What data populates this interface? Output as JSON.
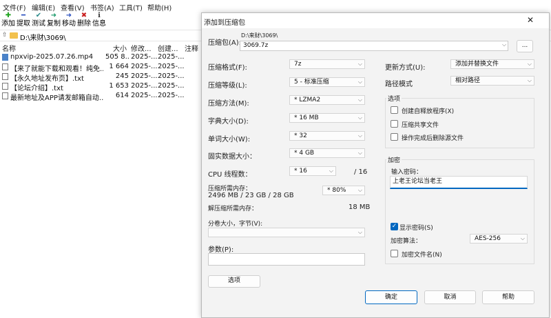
{
  "menu": [
    "文件(F)",
    "编辑(E)",
    "查看(V)",
    "书签(A)",
    "工具(T)",
    "帮助(H)"
  ],
  "toolbar": [
    {
      "label": "添加",
      "icon": "add-icon",
      "glyph": "✚",
      "color": "#1fa31f"
    },
    {
      "label": "提取",
      "icon": "extract-icon",
      "glyph": "━",
      "color": "#2a4fbf"
    },
    {
      "label": "测试",
      "icon": "test-icon",
      "glyph": "✔",
      "color": "#2b8a8a"
    },
    {
      "label": "复制",
      "icon": "copy-icon",
      "glyph": "➜",
      "color": "#1c9a6b"
    },
    {
      "label": "移动",
      "icon": "move-icon",
      "glyph": "➜",
      "color": "#2a4fbf"
    },
    {
      "label": "删除",
      "icon": "delete-icon",
      "glyph": "✖",
      "color": "#c81e1e"
    },
    {
      "label": "信息",
      "icon": "info-icon",
      "glyph": "ℹ",
      "color": "#333333"
    }
  ],
  "address": "D:\\来财\\3069\\",
  "columns": {
    "name": "名称",
    "size": "大小",
    "modified": "修改...",
    "created": "创建...",
    "comment": "注释"
  },
  "files": [
    {
      "name": "npxvip-2025.07.26.mp4",
      "size": "505 8...",
      "modified": "2025-...",
      "created": "2025-..."
    },
    {
      "name": "【来了就能下载和观看！纯免...",
      "size": "1 664",
      "modified": "2025-...",
      "created": "2025-..."
    },
    {
      "name": "【永久地址发布页】.txt",
      "size": "245",
      "modified": "2025-...",
      "created": "2025-..."
    },
    {
      "name": "【论坛介绍】.txt",
      "size": "1 653",
      "modified": "2025-...",
      "created": "2025-..."
    },
    {
      "name": "最新地址及APP请发邮箱自动...",
      "size": "614",
      "modified": "2025-...",
      "created": "2025-..."
    }
  ],
  "dialog": {
    "title": "添加到压缩包",
    "close": "✕",
    "archive_label": "压缩包(A):",
    "archive_path": "D:\\来财\\3069\\",
    "archive_name": "3069.7z",
    "browse": "...",
    "format_label": "压缩格式(F):",
    "format_value": "7z",
    "level_label": "压缩等级(L):",
    "level_value": "5 - 标准压缩",
    "method_label": "压缩方法(M):",
    "method_value": "*  LZMA2",
    "dict_label": "字典大小(D):",
    "dict_value": "*  16 MB",
    "word_label": "单词大小(W):",
    "word_value": "*  32",
    "solid_label": "固实数据大小：",
    "solid_value": "*  4 GB",
    "cpu_label": "CPU 线程数：",
    "cpu_value": "*  16",
    "cpu_total": "/ 16",
    "mem_label": "压缩所需内存：",
    "mem_value": "2496 MB / 23 GB / 28 GB",
    "mem_pct": "* 80%",
    "decomp_label": "解压缩所需内存：",
    "decomp_value": "18 MB",
    "split_label": "分卷大小，字节(V):",
    "split_value": "",
    "params_label": "参数(P):",
    "params_value": "",
    "options_btn": "选项",
    "update_label": "更新方式(U):",
    "update_value": "添加并替换文件",
    "path_label": "路径模式",
    "path_value": "相对路径",
    "opts_group": "选项",
    "opt_sfx": "创建自释放程序(X)",
    "opt_shared": "压缩共享文件",
    "opt_delete": "操作完成后删除源文件",
    "enc_group": "加密",
    "pwd_label": "输入密码：",
    "pwd_value": "上老王论坛当老王",
    "show_pwd": "显示密码(S)",
    "enc_method_label": "加密算法：",
    "enc_method_value": "AES-256",
    "enc_names": "加密文件名(N)",
    "ok": "确定",
    "cancel": "取消",
    "help": "帮助"
  }
}
